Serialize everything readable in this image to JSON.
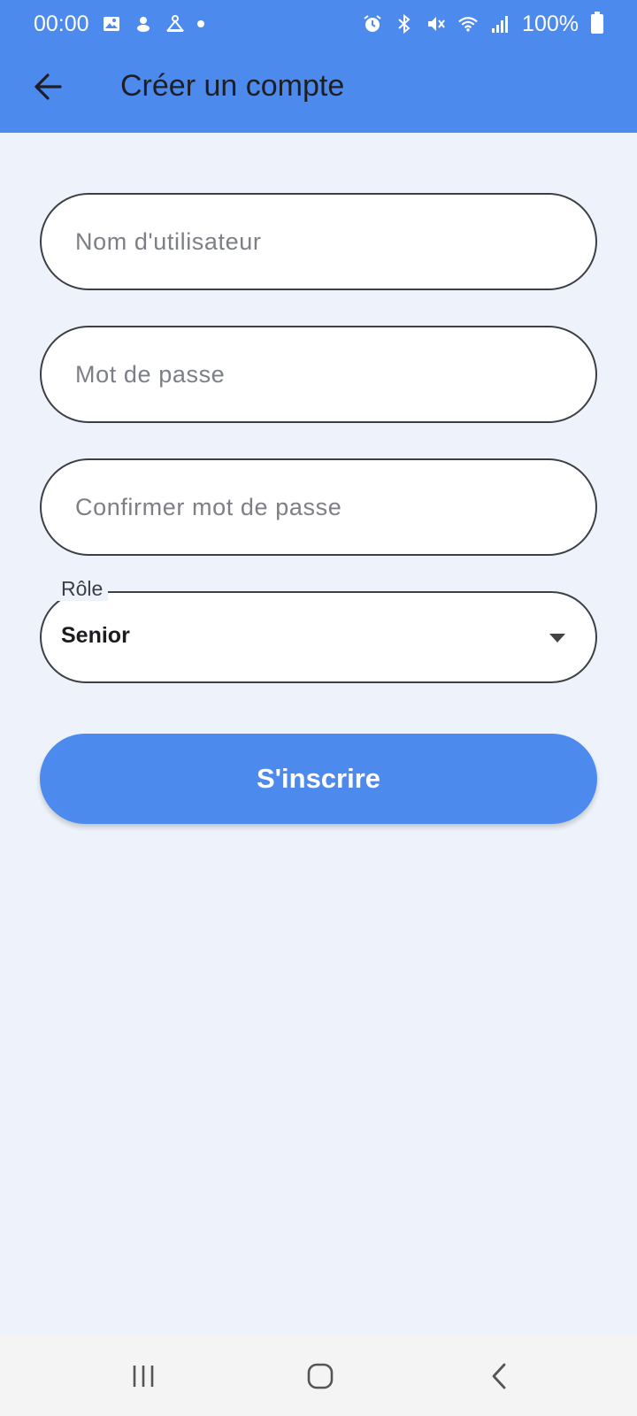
{
  "status_bar": {
    "time": "00:00",
    "battery": "100%"
  },
  "header": {
    "title": "Créer un compte"
  },
  "form": {
    "username_placeholder": "Nom d'utilisateur",
    "password_placeholder": "Mot de passe",
    "confirm_password_placeholder": "Confirmer mot de passe",
    "role_label": "Rôle",
    "role_value": "Senior",
    "submit_label": "S'inscrire"
  },
  "icons": {
    "back": "arrow-left-icon",
    "status_left": [
      "image-icon",
      "app-notification-icon",
      "app-notification-icon",
      "dot-icon"
    ],
    "status_right": [
      "alarm-icon",
      "bluetooth-icon",
      "mute-icon",
      "wifi-icon",
      "signal-icon",
      "battery-icon"
    ],
    "nav": [
      "recent-apps-icon",
      "home-icon",
      "back-icon"
    ]
  },
  "colors": {
    "primary": "#4d8aee",
    "background": "#eef3fb",
    "title_text": "#1d1f24"
  }
}
